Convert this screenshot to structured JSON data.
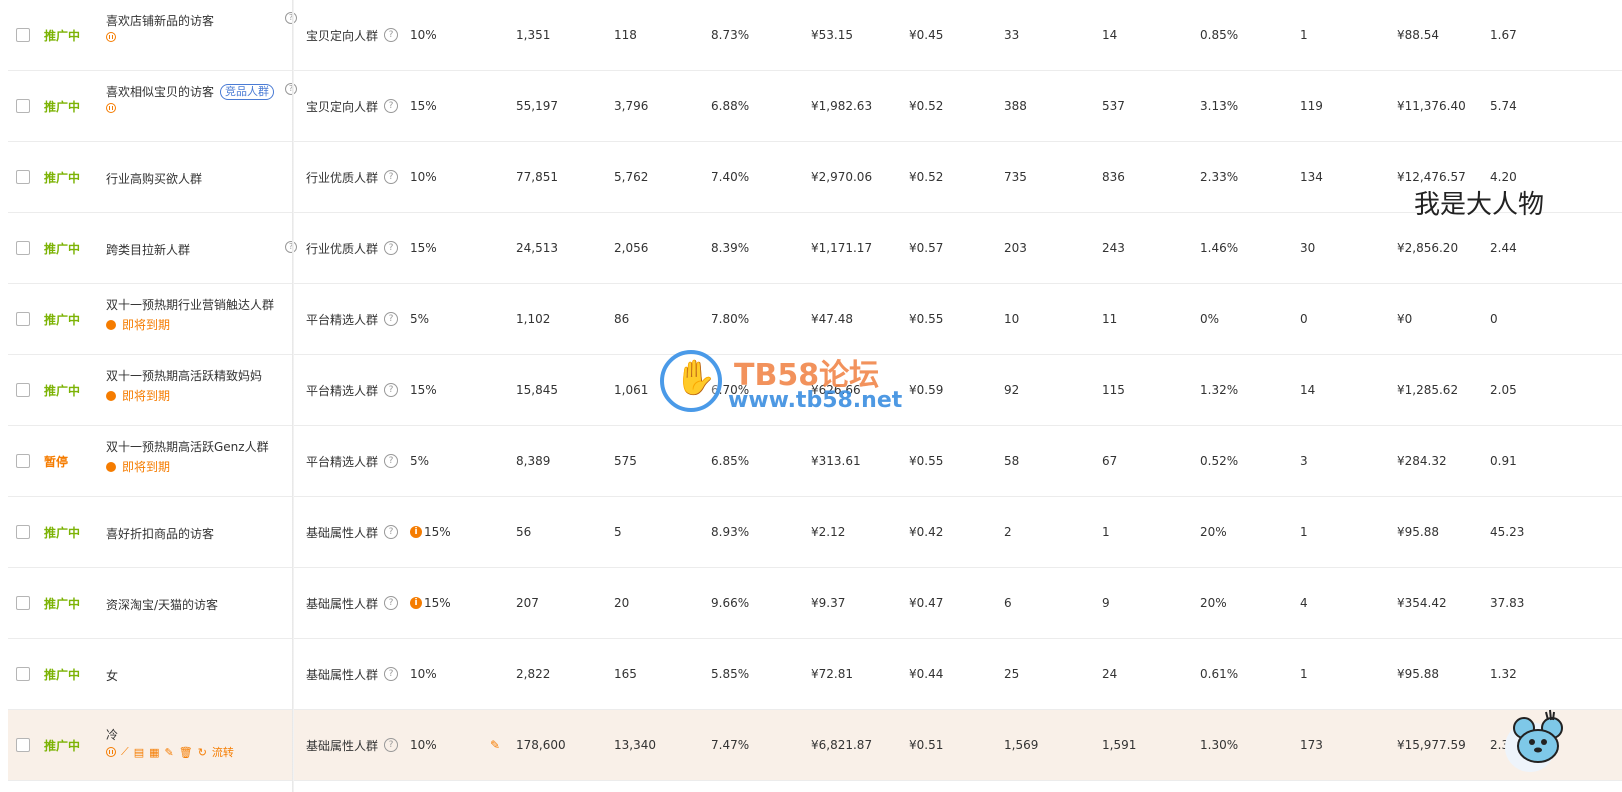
{
  "overlay": {
    "big_text": "我是大人物",
    "watermark_title": "TB58论坛",
    "watermark_url": "www.tb58.net"
  },
  "colors": {
    "status_active": "#7cb305",
    "status_paused": "#f57c00",
    "highlight_row": "#f9f0e8",
    "tag_blue": "#4a7bd4"
  },
  "rows": [
    {
      "status": "推广中",
      "name": "喜欢店铺新品的访客",
      "type": "宝贝定向人群",
      "ratio": "10%",
      "show": "1,351",
      "click": "118",
      "ctr": "8.73%",
      "cost": "¥53.15",
      "cpc": "¥0.45",
      "fav": "33",
      "cart": "14",
      "cvr": "0.85%",
      "deal": "1",
      "amount": "¥88.54",
      "roi": "1.67"
    },
    {
      "status": "推广中",
      "name": "喜欢相似宝贝的访客",
      "tag": "竞品人群",
      "type": "宝贝定向人群",
      "ratio": "15%",
      "show": "55,197",
      "click": "3,796",
      "ctr": "6.88%",
      "cost": "¥1,982.63",
      "cpc": "¥0.52",
      "fav": "388",
      "cart": "537",
      "cvr": "3.13%",
      "deal": "119",
      "amount": "¥11,376.40",
      "roi": "5.74"
    },
    {
      "status": "推广中",
      "name": "行业高购买欲人群",
      "type": "行业优质人群",
      "ratio": "10%",
      "show": "77,851",
      "click": "5,762",
      "ctr": "7.40%",
      "cost": "¥2,970.06",
      "cpc": "¥0.52",
      "fav": "735",
      "cart": "836",
      "cvr": "2.33%",
      "deal": "134",
      "amount": "¥12,476.57",
      "roi": "4.20"
    },
    {
      "status": "推广中",
      "name": "跨类目拉新人群",
      "type": "行业优质人群",
      "ratio": "15%",
      "show": "24,513",
      "click": "2,056",
      "ctr": "8.39%",
      "cost": "¥1,171.17",
      "cpc": "¥0.57",
      "fav": "203",
      "cart": "243",
      "cvr": "1.46%",
      "deal": "30",
      "amount": "¥2,856.20",
      "roi": "2.44"
    },
    {
      "status": "推广中",
      "name": "双十一预热期行业营销触达人群",
      "expire": "即将到期",
      "type": "平台精选人群",
      "ratio": "5%",
      "show": "1,102",
      "click": "86",
      "ctr": "7.80%",
      "cost": "¥47.48",
      "cpc": "¥0.55",
      "fav": "10",
      "cart": "11",
      "cvr": "0%",
      "deal": "0",
      "amount": "¥0",
      "roi": "0"
    },
    {
      "status": "推广中",
      "name": "双十一预热期高活跃精致妈妈",
      "expire": "即将到期",
      "type": "平台精选人群",
      "ratio": "15%",
      "show": "15,845",
      "click": "1,061",
      "ctr": "6.70%",
      "cost": "¥626.66",
      "cpc": "¥0.59",
      "fav": "92",
      "cart": "115",
      "cvr": "1.32%",
      "deal": "14",
      "amount": "¥1,285.62",
      "roi": "2.05"
    },
    {
      "status": "暂停",
      "name": "双十一预热期高活跃Genz人群",
      "expire": "即将到期",
      "type": "平台精选人群",
      "ratio": "5%",
      "show": "8,389",
      "click": "575",
      "ctr": "6.85%",
      "cost": "¥313.61",
      "cpc": "¥0.55",
      "fav": "58",
      "cart": "67",
      "cvr": "0.52%",
      "deal": "3",
      "amount": "¥284.32",
      "roi": "0.91"
    },
    {
      "status": "推广中",
      "name": "喜好折扣商品的访客",
      "type": "基础属性人群",
      "ratio": "15%",
      "show": "56",
      "click": "5",
      "ctr": "8.93%",
      "cost": "¥2.12",
      "cpc": "¥0.42",
      "fav": "2",
      "cart": "1",
      "cvr": "20%",
      "deal": "1",
      "amount": "¥95.88",
      "roi": "45.23"
    },
    {
      "status": "推广中",
      "name": "资深淘宝/天猫的访客",
      "type": "基础属性人群",
      "ratio": "15%",
      "show": "207",
      "click": "20",
      "ctr": "9.66%",
      "cost": "¥9.37",
      "cpc": "¥0.47",
      "fav": "6",
      "cart": "9",
      "cvr": "20%",
      "deal": "4",
      "amount": "¥354.42",
      "roi": "37.83"
    },
    {
      "status": "推广中",
      "name": "女",
      "type": "基础属性人群",
      "ratio": "10%",
      "show": "2,822",
      "click": "165",
      "ctr": "5.85%",
      "cost": "¥72.81",
      "cpc": "¥0.44",
      "fav": "25",
      "cart": "24",
      "cvr": "0.61%",
      "deal": "1",
      "amount": "¥95.88",
      "roi": "1.32"
    },
    {
      "status": "推广中",
      "name": "冷",
      "action_label": "流转",
      "type": "基础属性人群",
      "ratio": "10%",
      "show": "178,600",
      "click": "13,340",
      "ctr": "7.47%",
      "cost": "¥6,821.87",
      "cpc": "¥0.51",
      "fav": "1,569",
      "cart": "1,591",
      "cvr": "1.30%",
      "deal": "173",
      "amount": "¥15,977.59",
      "roi": "2.34"
    }
  ]
}
